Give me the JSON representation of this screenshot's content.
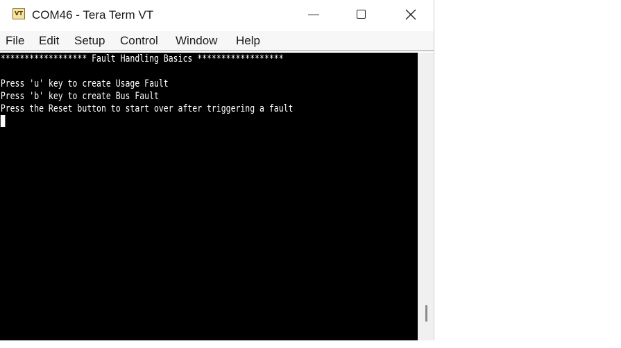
{
  "window": {
    "title": "COM46 - Tera Term VT",
    "icon_text": "VT",
    "icon": "teraterm-vt-icon"
  },
  "controls": {
    "minimize": "minimize-icon",
    "maximize": "maximize-icon",
    "close": "close-icon"
  },
  "menu": {
    "items": [
      {
        "label": "File"
      },
      {
        "label": "Edit"
      },
      {
        "label": "Setup"
      },
      {
        "label": "Control"
      },
      {
        "label": "Window"
      },
      {
        "label": "Help"
      }
    ]
  },
  "terminal": {
    "lines": [
      "****************** Fault Handling Basics ******************",
      "",
      "Press 'u' key to create Usage Fault",
      "Press 'b' key to create Bus Fault",
      "Press the Reset button to start over after triggering a fault"
    ],
    "background": "#000000",
    "foreground": "#ffffff"
  }
}
